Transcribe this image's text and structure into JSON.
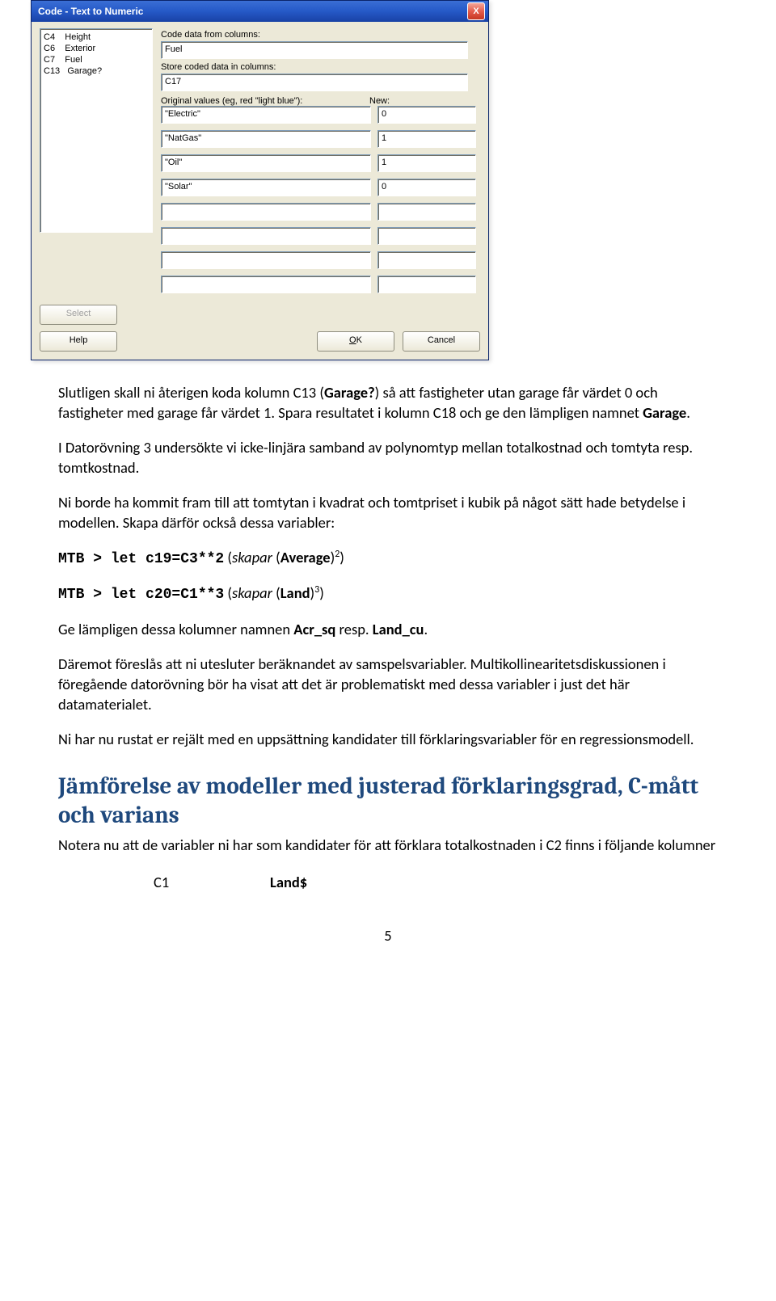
{
  "dialog": {
    "title": "Code - Text to Numeric",
    "close": "X",
    "columns_text": "C4    Height\nC6    Exterior\nC7    Fuel\nC13   Garage?",
    "code_from_lbl": "Code data from columns:",
    "code_from_val": "Fuel",
    "store_lbl": "Store coded data in columns:",
    "store_val": "C17",
    "orig_lbl": "Original values (eg,  red  \"light blue\"):",
    "new_lbl": "New:",
    "rows": [
      {
        "orig": "\"Electric\"",
        "nv": "0"
      },
      {
        "orig": "\"NatGas\"",
        "nv": "1"
      },
      {
        "orig": "\"Oil\"",
        "nv": "1"
      },
      {
        "orig": "\"Solar\"",
        "nv": "0"
      },
      {
        "orig": "",
        "nv": ""
      },
      {
        "orig": "",
        "nv": ""
      },
      {
        "orig": "",
        "nv": ""
      },
      {
        "orig": "",
        "nv": ""
      }
    ],
    "select_btn": "Select",
    "help_btn": "Help",
    "ok_btn": "OK",
    "cancel_btn": "Cancel"
  },
  "doc": {
    "p1a": "Slutligen skall ni återigen koda kolumn C13 (",
    "p1b": "Garage?",
    "p1c": ")  så att fastigheter utan garage får värdet 0 och fastigheter med garage får värdet 1. Spara resultatet i kolumn C18 och ge den lämpligen namnet ",
    "p1d": "Garage",
    "p1e": ".",
    "p2": "I Datorövning 3 undersökte vi icke-linjära samband av polynomtyp mellan totalkostnad och tomtyta resp. tomtkostnad.",
    "p3": "Ni borde ha kommit fram till att tomtytan i kvadrat och tomtpriset i kubik på något sätt hade betydelse i modellen. Skapa därför också dessa variabler:",
    "code1a": "MTB > ",
    "code1b": "let c19=C3**2",
    "code1c": " (",
    "code1d": "skapar",
    "code1e": " (",
    "code1f": "Average",
    "code1g": ")",
    "code1h": "2",
    "code1i": ")",
    "code2a": "MTB > ",
    "code2b": "let c20=C1**3",
    "code2c": " (",
    "code2d": "skapar",
    "code2e": " (",
    "code2f": "Land",
    "code2g": ")",
    "code2h": "3",
    "code2i": ")",
    "p4a": "Ge lämpligen dessa kolumner namnen ",
    "p4b": "Acr_sq",
    "p4c": " resp. ",
    "p4d": "Land_cu",
    "p4e": ".",
    "p5": "Däremot föreslås att ni utesluter beräknandet av samspelsvariabler. Multikollinearitetsdiskussionen i föregående datorövning bör ha visat att det är problematiskt med dessa variabler i just det här datamaterialet.",
    "p6": "Ni har nu rustat er rejält med en uppsättning kandidater till förklaringsvariabler för en regressionsmodell.",
    "h2": "Jämförelse av modeller med justerad förklaringsgrad, C-mått och varians",
    "p7": "Notera nu att de variabler ni har som kandidater för att förklara totalkostnaden i C2 finns i följande kolumner",
    "tbl_c": "C1",
    "tbl_n": "Land$",
    "pagenum": "5"
  }
}
